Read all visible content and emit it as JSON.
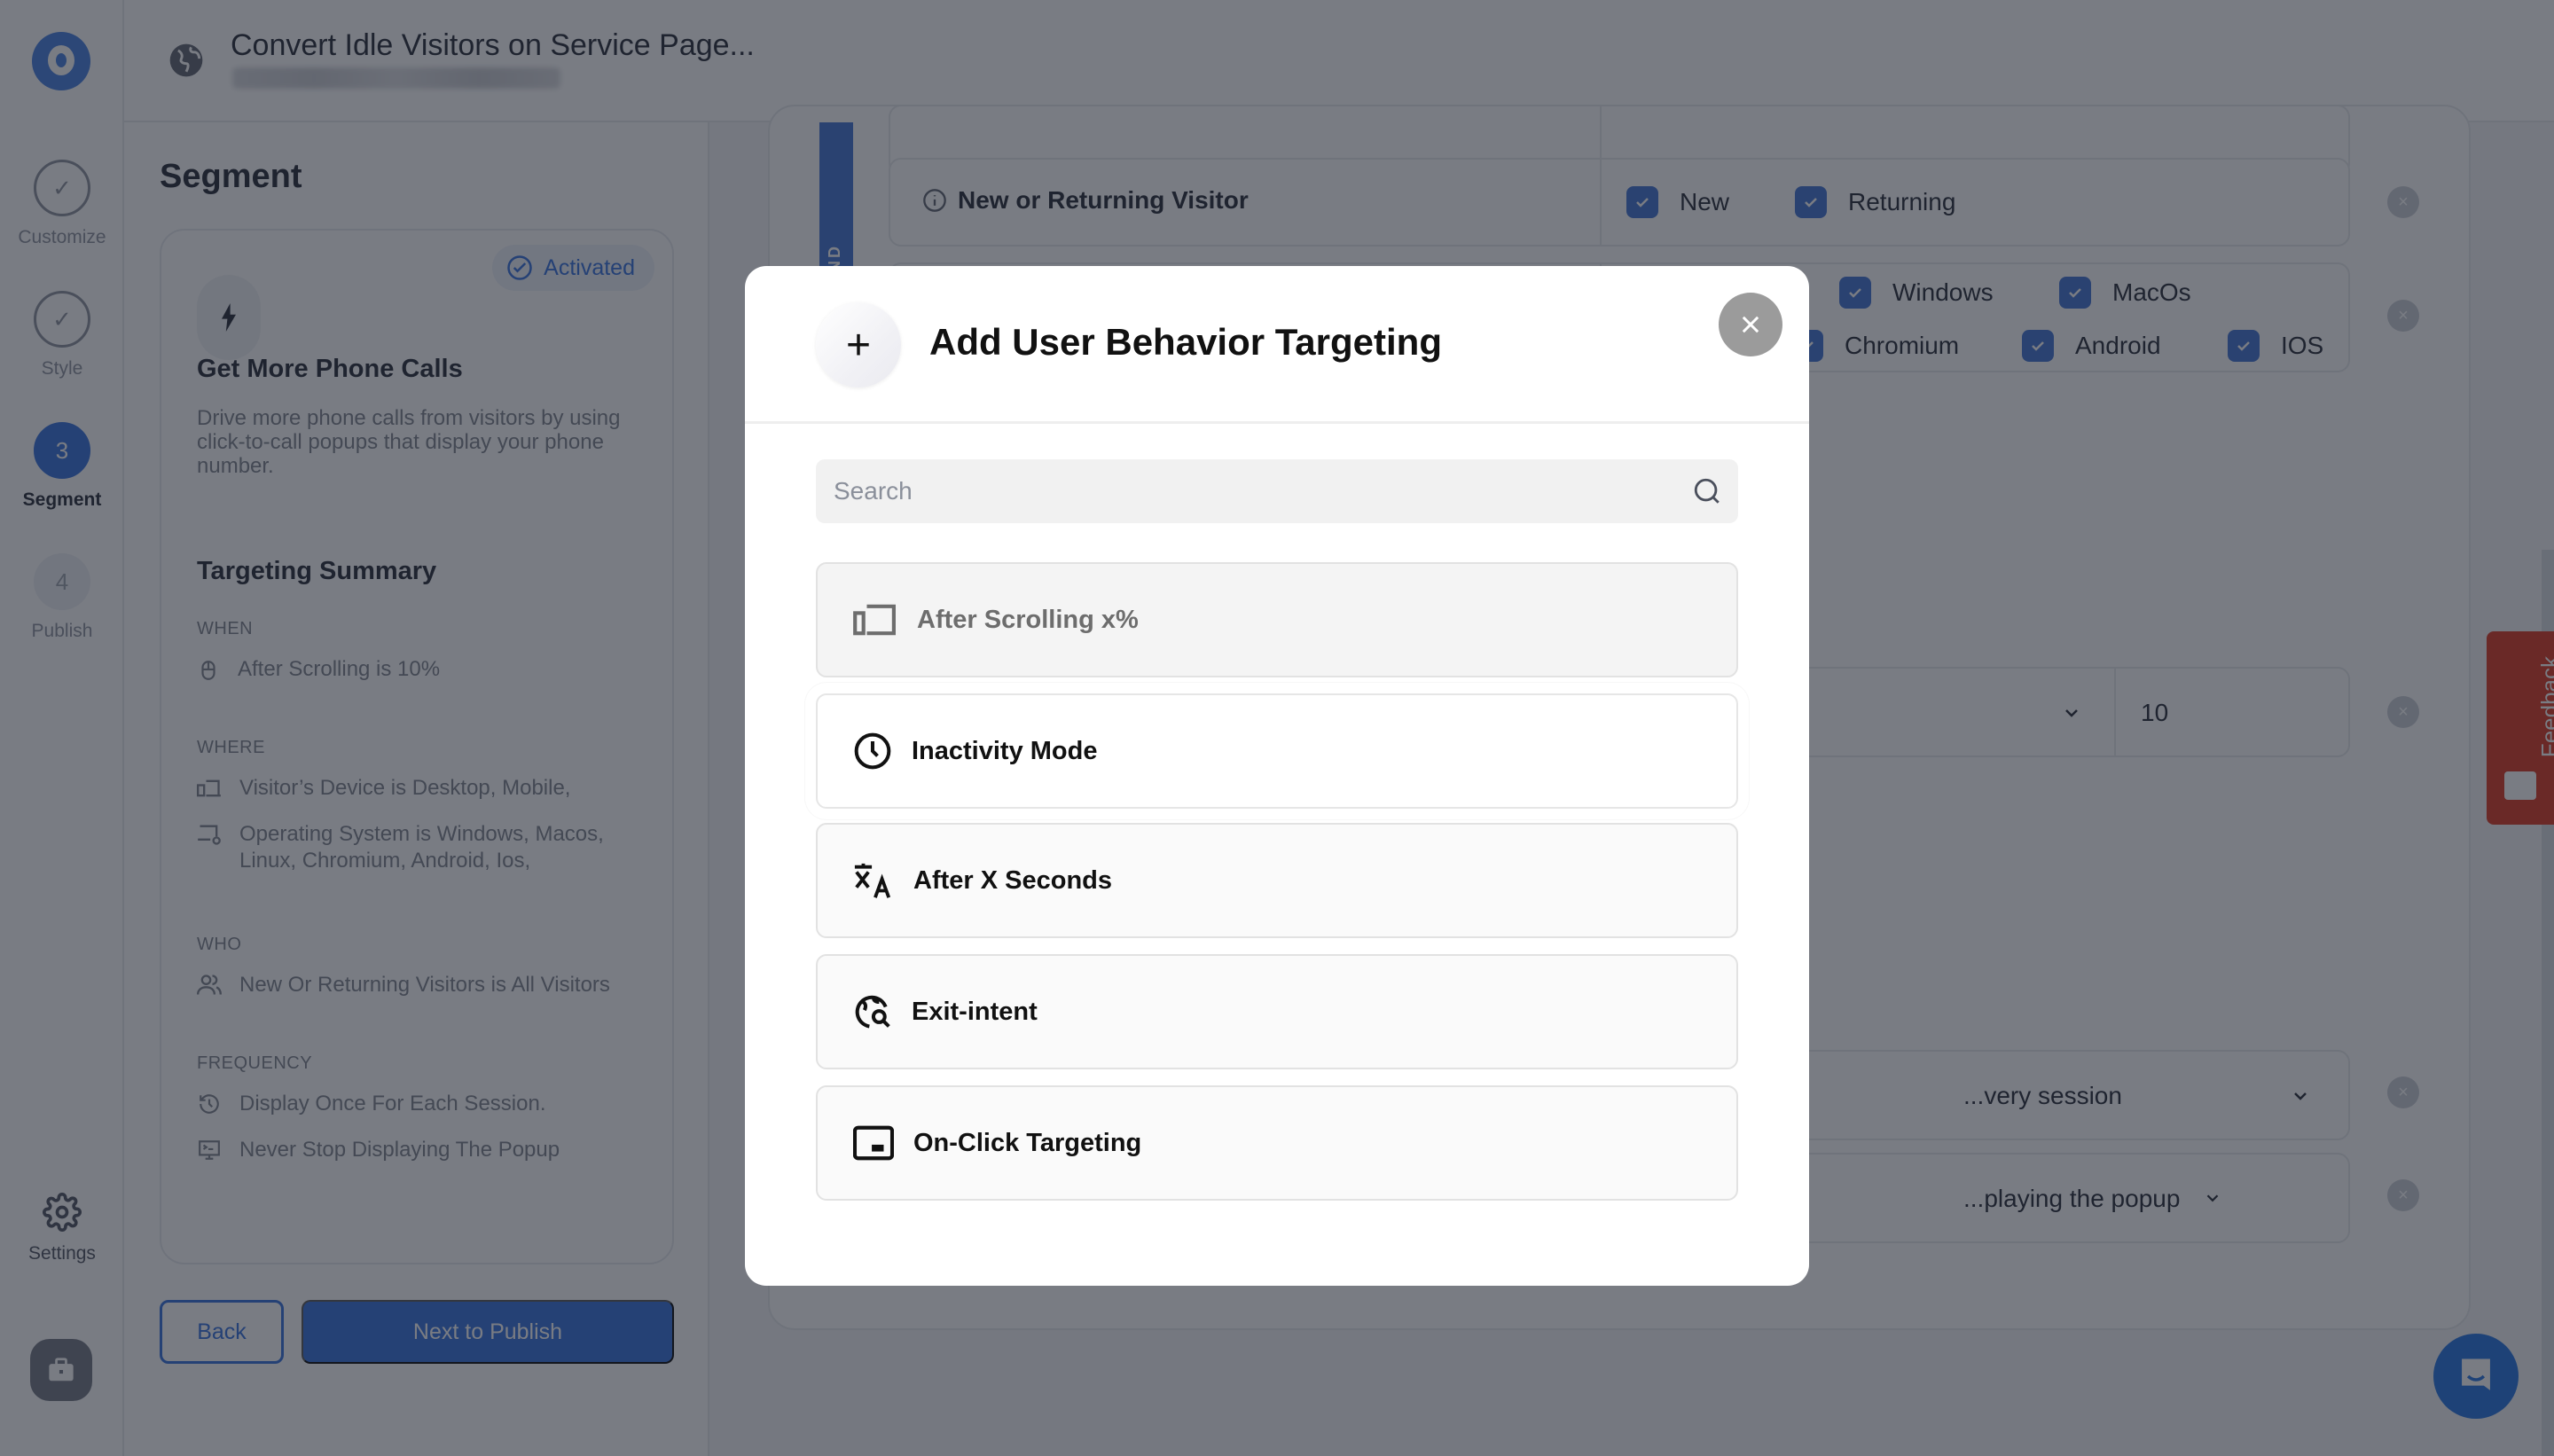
{
  "topbar": {
    "title": "Convert Idle Visitors on Service Page..."
  },
  "rail": {
    "steps": [
      {
        "label": "Customize",
        "state": "done"
      },
      {
        "label": "Style",
        "state": "done"
      },
      {
        "label": "Segment",
        "number": "3",
        "state": "active"
      },
      {
        "label": "Publish",
        "number": "4",
        "state": "future"
      }
    ],
    "settings_label": "Settings"
  },
  "left_panel": {
    "title": "Segment",
    "card": {
      "badge": "Activated",
      "heading": "Get More Phone Calls",
      "description": "Drive more phone calls from visitors by using click-to-call popups that display your phone number."
    },
    "summary": {
      "title": "Targeting Summary",
      "when_label": "WHEN",
      "when_items": [
        "After Scrolling is 10%"
      ],
      "where_label": "WHERE",
      "where_items": [
        "Visitor’s Device is Desktop, Mobile,",
        "Operating System is Windows, Macos, Linux, Chromium, Android, Ios,"
      ],
      "who_label": "WHO",
      "who_items": [
        "New Or Returning Visitors is All Visitors"
      ],
      "frequency_label": "FREQUENCY",
      "frequency_items": [
        "Display Once For Each Session.",
        "Never Stop Displaying The Popup"
      ]
    },
    "back_label": "Back",
    "next_label": "Next to Publish"
  },
  "main": {
    "and_label": "AND",
    "visitor_rule": {
      "label": "New or Returning Visitor",
      "options": [
        {
          "label": "New",
          "checked": true
        },
        {
          "label": "Returning",
          "checked": true
        }
      ]
    },
    "os_rule": {
      "options": [
        {
          "label": "Windows",
          "checked": true
        },
        {
          "label": "MacOs",
          "checked": true
        },
        {
          "label": "Chromium",
          "checked": true
        },
        {
          "label": "Android",
          "checked": true
        },
        {
          "label": "IOS",
          "checked": true
        }
      ]
    },
    "scroll_rule": {
      "value": "10"
    },
    "frequency_rule": {
      "value": "...very session"
    },
    "stop_rule": {
      "value": "...playing the popup"
    }
  },
  "feedback_label": "Feedback",
  "modal": {
    "title": "Add User Behavior Targeting",
    "search_placeholder": "Search",
    "search_value": "",
    "options": [
      {
        "label": "After Scrolling x%",
        "icon": "devices-icon",
        "state": "disabled"
      },
      {
        "label": "Inactivity Mode",
        "icon": "clock-icon",
        "state": "selected"
      },
      {
        "label": "After X Seconds",
        "icon": "translate-icon",
        "state": "default"
      },
      {
        "label": "Exit-intent",
        "icon": "globe-search-icon",
        "state": "default"
      },
      {
        "label": "On-Click Targeting",
        "icon": "tablet-click-icon",
        "state": "default"
      }
    ]
  },
  "colors": {
    "accent": "#2f6bdc",
    "feedback": "#d9301a",
    "chat": "#1d6fe0"
  }
}
